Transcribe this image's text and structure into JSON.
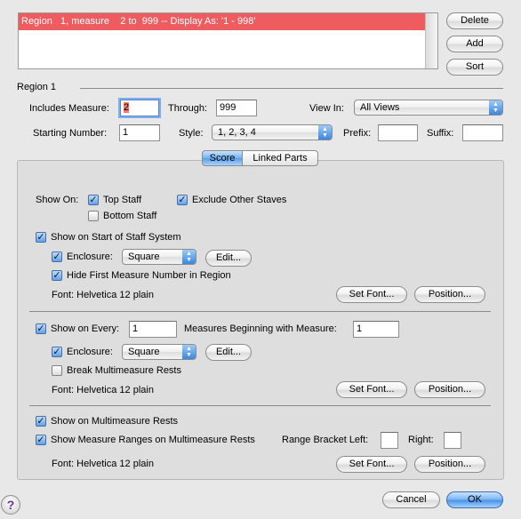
{
  "region_list": {
    "items": [
      "Region   1, measure    2 to  999 -- Display As: '1 - 998'"
    ]
  },
  "buttons": {
    "delete": "Delete",
    "add": "Add",
    "sort": "Sort",
    "cancel": "Cancel",
    "ok": "OK",
    "edit": "Edit...",
    "set_font": "Set Font...",
    "position": "Position..."
  },
  "region_group": {
    "title": "Region 1",
    "includes_measure_label": "Includes Measure:",
    "includes_measure_value": "2",
    "through_label": "Through:",
    "through_value": "999",
    "view_in_label": "View In:",
    "view_in_value": "All Views",
    "starting_number_label": "Starting Number:",
    "starting_number_value": "1",
    "style_label": "Style:",
    "style_value": "1, 2, 3, 4",
    "prefix_label": "Prefix:",
    "prefix_value": "",
    "suffix_label": "Suffix:",
    "suffix_value": ""
  },
  "tabs": [
    "Score",
    "Linked Parts"
  ],
  "section1": {
    "show_on_label": "Show On:",
    "top_staff": "Top Staff",
    "bottom_staff": "Bottom Staff",
    "exclude_other_staves": "Exclude Other Staves",
    "show_on_start": "Show on Start of Staff System",
    "enclosure_label": "Enclosure:",
    "enclosure_value": "Square",
    "hide_first": "Hide First Measure Number in Region",
    "font": "Font:  Helvetica 12 plain"
  },
  "section2": {
    "show_on_every_label": "Show on Every:",
    "show_on_every_value": "1",
    "measures_beginning_label": "Measures Beginning with Measure:",
    "measures_beginning_value": "1",
    "enclosure_label": "Enclosure:",
    "enclosure_value": "Square",
    "break_multimeasure": "Break Multimeasure Rests",
    "font": "Font:  Helvetica 12 plain"
  },
  "section3": {
    "show_on_multimeasure": "Show on Multimeasure Rests",
    "show_measure_ranges": "Show Measure Ranges on Multimeasure Rests",
    "range_bracket_left_label": "Range Bracket Left:",
    "range_bracket_left_value": "",
    "right_label": "Right:",
    "right_value": "",
    "font": "Font:  Helvetica 12 plain"
  },
  "help": "?"
}
